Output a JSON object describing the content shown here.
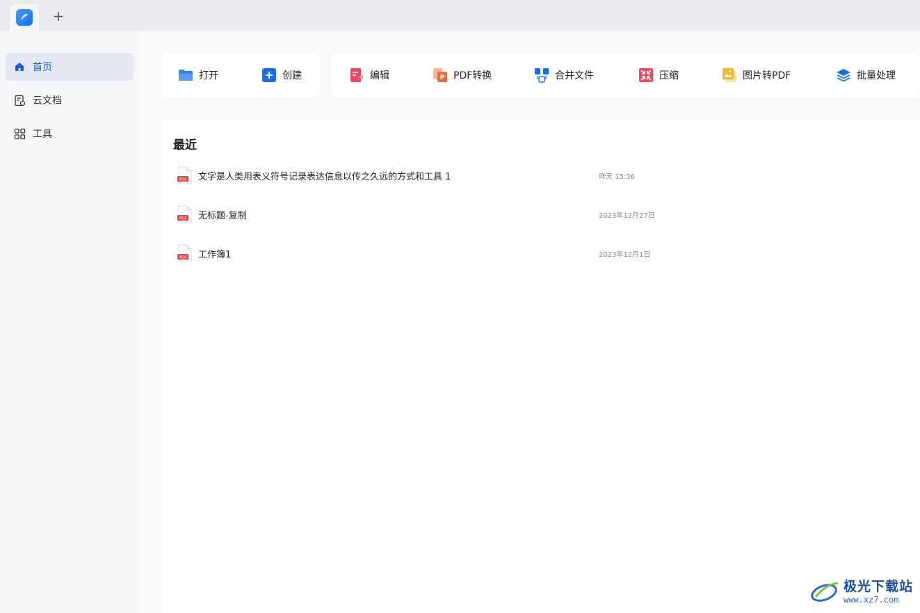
{
  "titlebar": {
    "new_tab_label": "+"
  },
  "sidebar": {
    "items": [
      {
        "label": "首页",
        "icon": "home-icon",
        "active": true
      },
      {
        "label": "云文档",
        "icon": "cloud-doc-icon",
        "active": false
      },
      {
        "label": "工具",
        "icon": "grid-icon",
        "active": false
      }
    ]
  },
  "quick_actions": [
    {
      "label": "打开",
      "icon": "folder-icon"
    },
    {
      "label": "创建",
      "icon": "plus-square-icon"
    }
  ],
  "toolbar": [
    {
      "label": "编辑",
      "icon": "edit-doc-icon"
    },
    {
      "label": "PDF转换",
      "icon": "pdf-convert-icon"
    },
    {
      "label": "合并文件",
      "icon": "merge-icon"
    },
    {
      "label": "压缩",
      "icon": "compress-icon"
    },
    {
      "label": "图片转PDF",
      "icon": "image-to-pdf-icon"
    },
    {
      "label": "批量处理",
      "icon": "layers-icon"
    }
  ],
  "recent": {
    "title": "最近",
    "files": [
      {
        "name": "文字是人类用表义符号记录表达信息以传之久远的方式和工具 1",
        "time": "昨天 15:36"
      },
      {
        "name": "无标题-复制",
        "time": "2023年12月27日"
      },
      {
        "name": "工作簿1",
        "time": "2023年12月1日"
      }
    ]
  },
  "watermark": {
    "name": "极光下载站",
    "url": "www.xz7.com"
  },
  "colors": {
    "accent": "#1a6fe8",
    "pdf_red": "#e04a4a",
    "sidebar_active_bg": "#e3e8f2"
  }
}
